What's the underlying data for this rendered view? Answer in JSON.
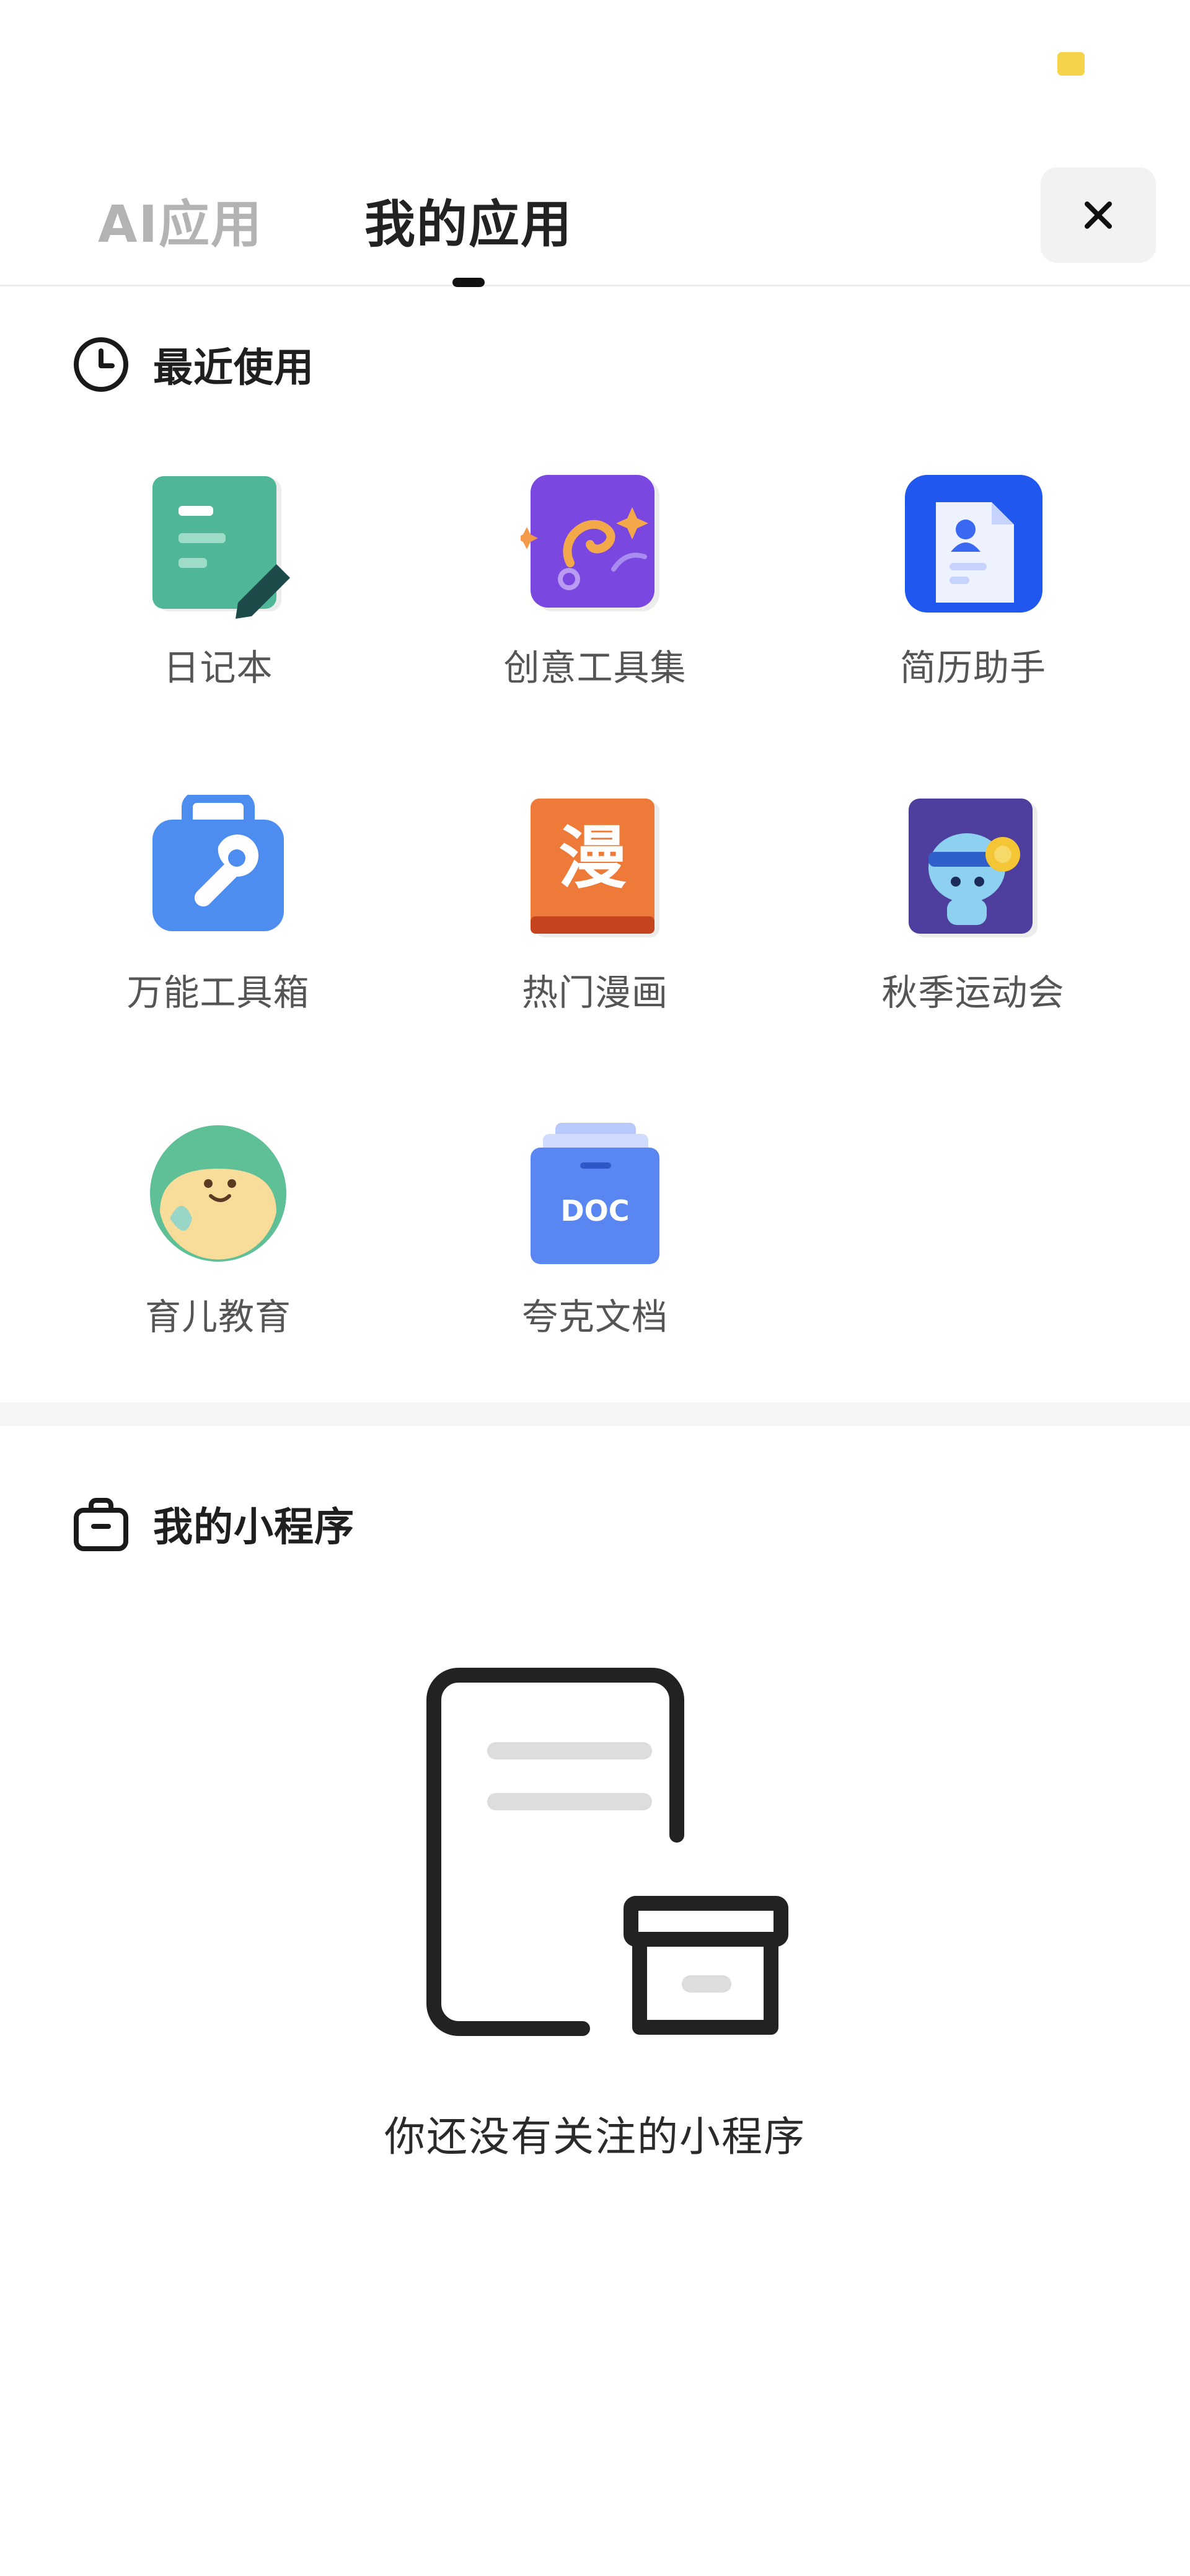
{
  "colors": {
    "accent_dot": "#f5d34a",
    "tab_active": "#222222",
    "tab_inactive": "#b3b3b3",
    "label": "#555555"
  },
  "tabs": {
    "ai_label": "AI应用",
    "mine_label": "我的应用",
    "active": "我的应用",
    "close_icon": "close-icon"
  },
  "recent": {
    "title": "最近使用",
    "icon": "clock-icon",
    "apps": [
      {
        "label": "日记本",
        "icon": "diary-icon"
      },
      {
        "label": "创意工具集",
        "icon": "creative-tools-icon"
      },
      {
        "label": "简历助手",
        "icon": "resume-icon"
      },
      {
        "label": "万能工具箱",
        "icon": "toolbox-icon"
      },
      {
        "label": "热门漫画",
        "icon": "comics-icon",
        "glyph": "漫"
      },
      {
        "label": "秋季运动会",
        "icon": "sports-meet-icon"
      },
      {
        "label": "育儿教育",
        "icon": "parenting-icon"
      },
      {
        "label": "夸克文档",
        "icon": "quark-doc-icon",
        "glyph": "DOC"
      }
    ]
  },
  "mini_programs": {
    "title": "我的小程序",
    "icon": "bag-icon",
    "empty_text": "你还没有关注的小程序",
    "empty_icon": "empty-archive-illustration"
  }
}
